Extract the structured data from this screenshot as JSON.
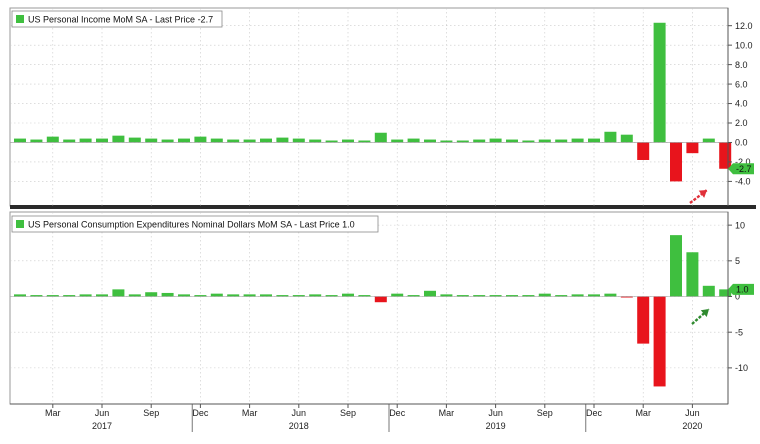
{
  "colors": {
    "positive": "#3fbf3f",
    "negative": "#e8141c",
    "badge": "#3fbf3f",
    "arrow_top": "#e0303a",
    "arrow_bottom": "#2f8a2f",
    "grid": "#c9c9c9"
  },
  "x_axis": {
    "month_labels": [
      "Mar",
      "Jun",
      "Sep",
      "Dec",
      "Mar",
      "Jun",
      "Sep",
      "Dec",
      "Mar",
      "Jun",
      "Sep",
      "Dec",
      "Mar",
      "Jun"
    ],
    "month_index": [
      2,
      5,
      8,
      11,
      14,
      17,
      20,
      23,
      26,
      29,
      32,
      35,
      38,
      41
    ],
    "year_labels": [
      "2017",
      "2018",
      "2019",
      "2020"
    ],
    "year_index": [
      5,
      17,
      29,
      41
    ]
  },
  "chart_data": [
    {
      "type": "bar",
      "legend": "US Personal Income MoM SA - Last Price -2.7",
      "last_value": "-2.7",
      "ylim": [
        -5.5,
        13.2
      ],
      "yticks": [
        -4.0,
        -2.0,
        0.0,
        2.0,
        4.0,
        6.0,
        8.0,
        10.0,
        12.0
      ],
      "ytick_labels": [
        "-4.0",
        "-2.0",
        "0.0",
        "2.0",
        "4.0",
        "6.0",
        "8.0",
        "10.0",
        "12.0"
      ],
      "values": [
        0.4,
        0.3,
        0.6,
        0.3,
        0.4,
        0.4,
        0.7,
        0.5,
        0.4,
        0.3,
        0.4,
        0.6,
        0.4,
        0.3,
        0.3,
        0.4,
        0.5,
        0.4,
        0.3,
        0.2,
        0.3,
        0.2,
        1.0,
        0.3,
        0.4,
        0.3,
        0.2,
        0.2,
        0.3,
        0.4,
        0.3,
        0.2,
        0.3,
        0.3,
        0.4,
        0.4,
        1.1,
        0.8,
        -1.8,
        12.3,
        -4.0,
        -1.1,
        0.4,
        -2.7
      ]
    },
    {
      "type": "bar",
      "legend": "US Personal Consumption Expenditures Nominal Dollars MoM SA - Last Price 1.0",
      "last_value": "1.0",
      "ylim": [
        -14.5,
        11
      ],
      "yticks": [
        -10,
        -5,
        0,
        5,
        10
      ],
      "ytick_labels": [
        "-10",
        "-5",
        "0",
        "5",
        "10"
      ],
      "values": [
        0.3,
        0.2,
        0.2,
        0.2,
        0.3,
        0.3,
        1.0,
        0.3,
        0.6,
        0.5,
        0.3,
        0.2,
        0.4,
        0.3,
        0.3,
        0.3,
        0.2,
        0.2,
        0.3,
        0.2,
        0.4,
        0.2,
        -0.8,
        0.4,
        0.2,
        0.8,
        0.3,
        0.2,
        0.2,
        0.2,
        0.2,
        0.2,
        0.4,
        0.2,
        0.3,
        0.3,
        0.4,
        -0.1,
        -6.6,
        -12.6,
        8.6,
        6.2,
        1.5,
        1.0
      ]
    }
  ]
}
